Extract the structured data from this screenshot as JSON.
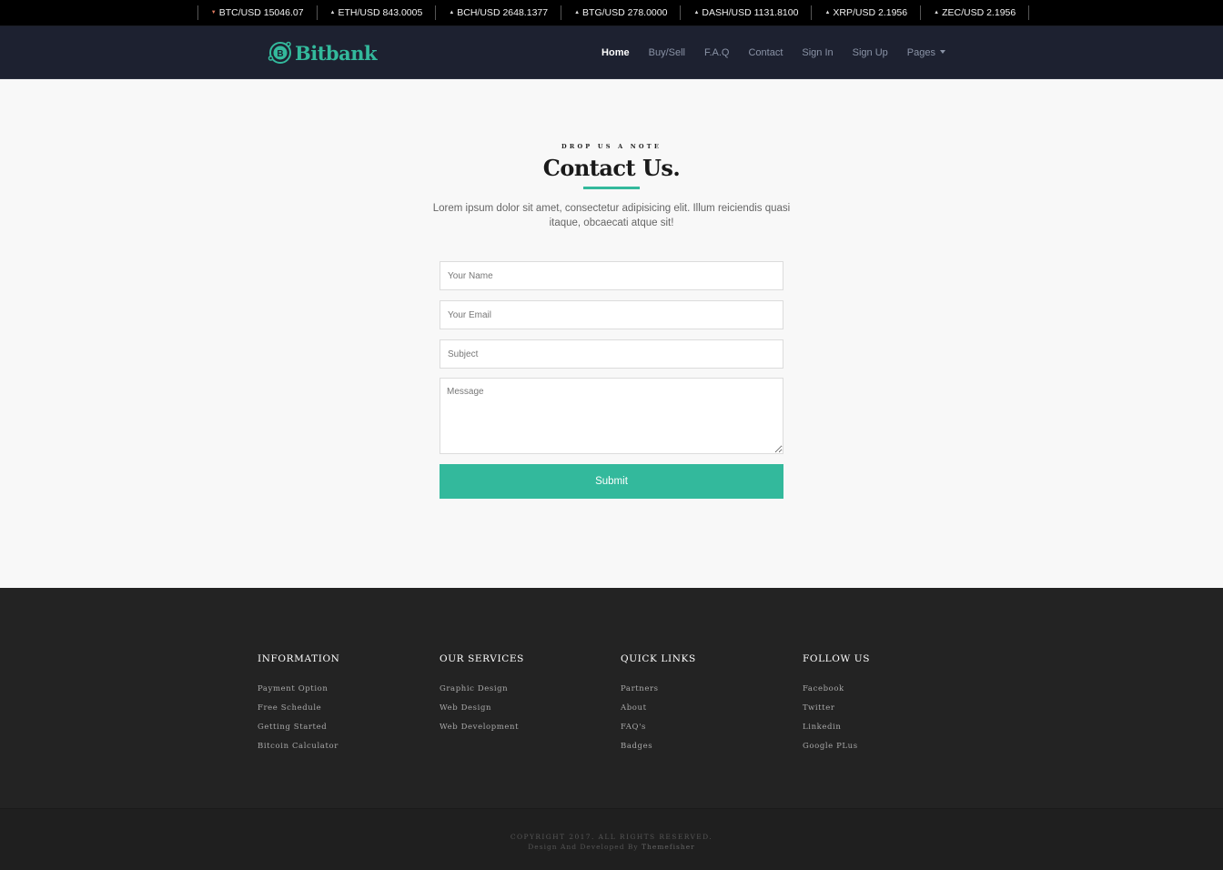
{
  "ticker": [
    {
      "symbol": "BTC/USD",
      "price": "15046.07",
      "direction": "down"
    },
    {
      "symbol": "ETH/USD",
      "price": "843.0005",
      "direction": "up"
    },
    {
      "symbol": "BCH/USD",
      "price": "2648.1377",
      "direction": "up"
    },
    {
      "symbol": "BTG/USD",
      "price": "278.0000",
      "direction": "up"
    },
    {
      "symbol": "DASH/USD",
      "price": "1131.8100",
      "direction": "up"
    },
    {
      "symbol": "XRP/USD",
      "price": "2.1956",
      "direction": "up"
    },
    {
      "symbol": "ZEC/USD",
      "price": "2.1956",
      "direction": "up"
    }
  ],
  "brand": {
    "name": "Bitbank",
    "icon": "bitcoin-circle-icon",
    "color": "#33b99c"
  },
  "nav": {
    "home": "Home",
    "buy_sell": "Buy/Sell",
    "faq": "F.A.Q",
    "contact": "Contact",
    "sign_in": "Sign In",
    "sign_up": "Sign Up",
    "pages": "Pages"
  },
  "contact": {
    "eyebrow": "DROP US A NOTE",
    "title": "Contact Us.",
    "lead": "Lorem ipsum dolor sit amet, consectetur adipisicing elit. Illum reiciendis quasi itaque, obcaecati atque sit!",
    "name_placeholder": "Your Name",
    "email_placeholder": "Your Email",
    "subject_placeholder": "Subject",
    "message_placeholder": "Message",
    "submit_label": "Submit"
  },
  "footer": {
    "information": {
      "title": "INFORMATION",
      "links": [
        "Payment Option",
        "Free Schedule",
        "Getting Started",
        "Bitcoin Calculator"
      ]
    },
    "services": {
      "title": "OUR SERVICES",
      "links": [
        "Graphic Design",
        "Web Design",
        "Web Development"
      ]
    },
    "quick_links": {
      "title": "QUICK LINKS",
      "links": [
        "Partners",
        "About",
        "FAQ's",
        "Badges"
      ]
    },
    "follow": {
      "title": "FOLLOW US",
      "links": [
        "Facebook",
        "Twitter",
        "Linkedin",
        "Google PLus"
      ]
    },
    "copyright": "COPYRIGHT 2017. ALL RIGHTS RESERVED.",
    "credit_prefix": "Design And Developed By",
    "credit_name": "Themefisher"
  }
}
